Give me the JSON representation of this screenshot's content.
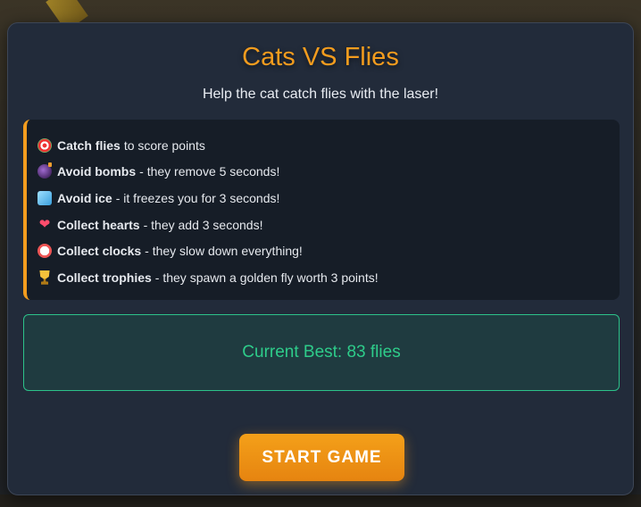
{
  "modal": {
    "title": "Cats VS Flies",
    "subtitle": "Help the cat catch flies with the laser!"
  },
  "rules": [
    {
      "icon": "target-icon",
      "strong": "Catch flies",
      "text": "to score points"
    },
    {
      "icon": "bomb-icon",
      "strong": "Avoid bombs",
      "text": "- they remove 5 seconds!"
    },
    {
      "icon": "ice-cube-icon",
      "strong": "Avoid ice",
      "text": "- it freezes you for 3 seconds!"
    },
    {
      "icon": "heart-icon",
      "strong": "Collect hearts",
      "text": "- they add 3 seconds!"
    },
    {
      "icon": "alarm-clock-icon",
      "strong": "Collect clocks",
      "text": "- they slow down everything!"
    },
    {
      "icon": "trophy-icon",
      "strong": "Collect trophies",
      "text": "- they spawn a golden fly worth 3 points!"
    }
  ],
  "best": {
    "text": "Current Best: 83 flies"
  },
  "start_button": {
    "label": "START GAME"
  },
  "colors": {
    "accent": "#f39c1e",
    "success": "#2ecc8a",
    "panel": "#222b3a"
  }
}
